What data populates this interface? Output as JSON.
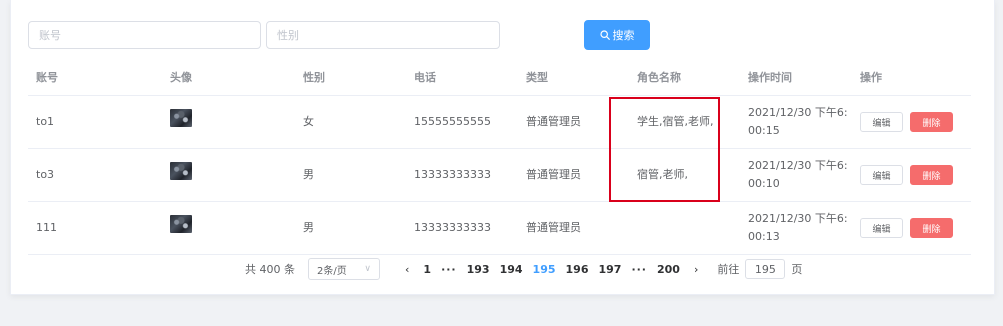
{
  "search": {
    "account_placeholder": "账号",
    "gender_placeholder": "性别",
    "search_label": "搜索"
  },
  "table": {
    "headers": {
      "account": "账号",
      "avatar": "头像",
      "gender": "性别",
      "phone": "电话",
      "type": "类型",
      "roles": "角色名称",
      "time": "操作时间",
      "ops": "操作"
    },
    "rows": [
      {
        "account": "to1",
        "gender": "女",
        "phone": "15555555555",
        "type": "普通管理员",
        "roles": "学生,宿管,老师,",
        "time_line1": "2021/12/30 下午6:",
        "time_line2": "00:15"
      },
      {
        "account": "to3",
        "gender": "男",
        "phone": "13333333333",
        "type": "普通管理员",
        "roles": "宿管,老师,",
        "time_line1": "2021/12/30 下午6:",
        "time_line2": "00:10"
      },
      {
        "account": "111",
        "gender": "男",
        "phone": "13333333333",
        "type": "普通管理员",
        "roles": "",
        "time_line1": "2021/12/30 下午6:",
        "time_line2": "00:13"
      }
    ],
    "edit_label": "编辑",
    "delete_label": "删除"
  },
  "pagination": {
    "total": "共 400 条",
    "page_size": "2条/页",
    "prev": "‹",
    "next": "›",
    "pages": [
      "1",
      "···",
      "193",
      "194",
      "195",
      "196",
      "197",
      "···",
      "200"
    ],
    "current": "195",
    "goto_label": "前往",
    "goto_value": "195",
    "goto_suffix": "页"
  },
  "colors": {
    "primary": "#409eff",
    "danger": "#f56c6c",
    "highlight_box": "#d9001b"
  }
}
